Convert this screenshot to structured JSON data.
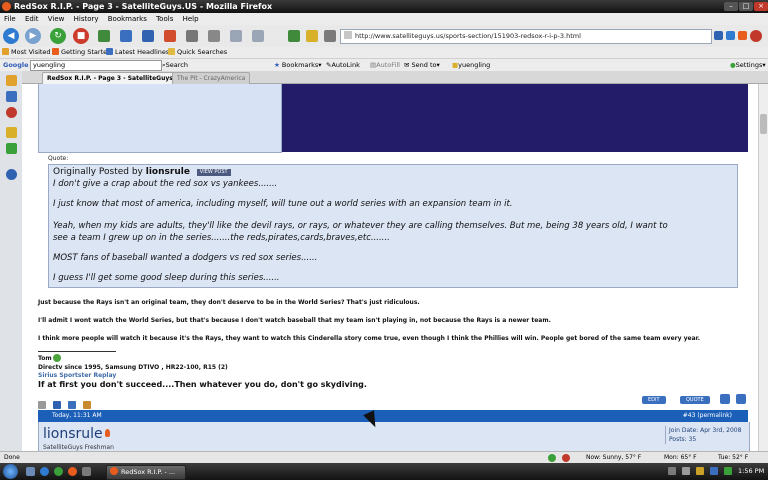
{
  "window": {
    "title": "RedSox R.I.P. - Page 3 - SatelliteGuys.US - Mozilla Firefox"
  },
  "menu": [
    "File",
    "Edit",
    "View",
    "History",
    "Bookmarks",
    "Tools",
    "Help"
  ],
  "nav": {
    "url": "http://www.satelliteguys.us/sports-section/151903-redsox-r-i-p-3.html"
  },
  "bookmarks": [
    "Most Visited",
    "Getting Started",
    "Latest Headlines",
    "Quick Searches"
  ],
  "googlebar": {
    "label": "Google",
    "query": "yuengling",
    "search": "Search",
    "bookmarks": "Bookmarks",
    "autolink": "AutoLink",
    "autofill": "AutoFill",
    "sendto": "Send to",
    "term": "yuengling",
    "settings": "Settings"
  },
  "tabs": [
    "RedSox R.I.P. - Page 3 - SatelliteGuys.US",
    "The Pit - CrazyAmerica"
  ],
  "quote": {
    "label": "Quote:",
    "prefix": "Originally Posted by",
    "author": "lionsrule",
    "viewpost": "VIEW POST",
    "lines": [
      "I don't give a crap about the red sox vs yankees.......",
      "I just know that most of america, including myself, will tune out a world series with an expansion team in it.",
      "Yeah, when my kids are adults, they'll like the devil rays, or rays, or whatever they are calling themselves. But me, being 38 years old, I want to",
      "see a team I grew up on in the series.......the reds,pirates,cards,braves,etc.......",
      "MOST fans of baseball wanted a dodgers vs red sox series......",
      "I guess I'll get some good sleep during this series......"
    ]
  },
  "post": {
    "paragraphs": [
      "Just because the Rays isn't an original team, they don't deserve to be in the World Series? That's just ridiculous.",
      "I'll admit I wont watch the World Series, but that's because I don't watch baseball that my team isn't playing in, not because the Rays is a newer team.",
      "I think more people will watch it because it's the Rays, they want to watch this Cinderella story come true, even though I think the Phillies will win. People get bored of the same team every year."
    ],
    "signature": {
      "name": "Tom",
      "line1": "Directv since 1995, Samsung DTIVO , HR22-100, R15 (2)",
      "line2": "Sirius Sportster Replay",
      "line3": "If at first you don't succeed....Then whatever you do, don't go skydiving."
    },
    "edit_label": "EDIT",
    "quote_label": "QUOTE"
  },
  "next_post": {
    "date": "Today, 11:31 AM",
    "number": "#43 (permalink)",
    "username": "lionsrule",
    "user_title": "SatelliteGuys Freshman",
    "join_date": "Join Date: Apr 3rd, 2008",
    "posts": "Posts: 35"
  },
  "status": {
    "text": "Done",
    "weather_now": "Now: Sunny, 57° F",
    "weather_mon": "Mon: 65° F",
    "weather_tue": "Tue: 52° F"
  },
  "taskbar": {
    "button": "RedSox R.I.P. - ...",
    "clock": "1:56 PM"
  },
  "colors": {
    "post_header": "#1c5fb8",
    "quote_bg": "#dce5f4",
    "banner": "#231d69"
  }
}
